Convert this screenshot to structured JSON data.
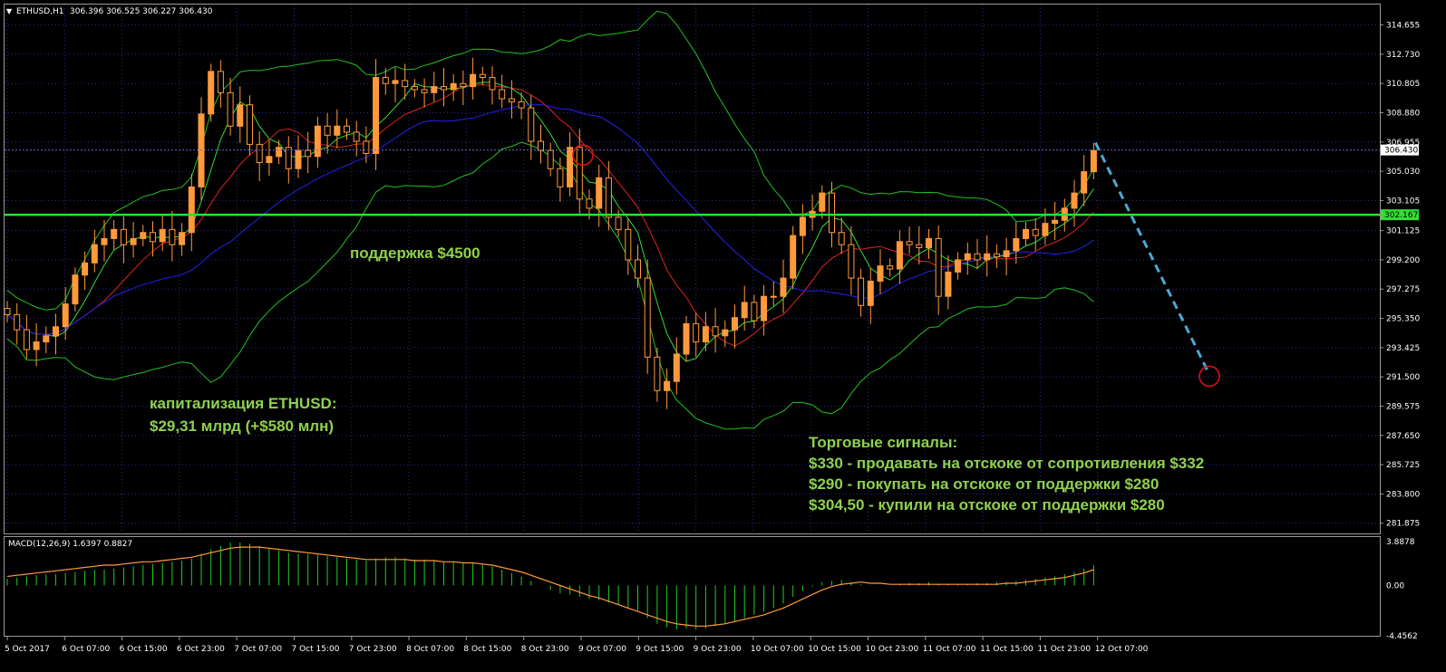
{
  "header": {
    "symbol": "ETHUSD,H1",
    "ohlc": "306.396 306.525 306.227 306.430"
  },
  "macd_header": "MACD(12,26,9) 1.6397 0.8827",
  "annotations": {
    "support_label": "поддержка $4500",
    "cap_line1": "капитализация ETHUSD:",
    "cap_line2": "$29,31 млрд (+$580 млн)",
    "signals_title": "Торговые сигналы:",
    "signal_1": "$330 - продавать на отскоке от сопротивления $332",
    "signal_2": "$290 - покупать на отскоке от поддержки $280",
    "signal_3": "$304,50 - купили на отскоке от поддержки $280"
  },
  "colors": {
    "background": "#000000",
    "grid": "#2b2b8a",
    "bull": "#ff9a3c",
    "bear": "#ff9a3c",
    "bollinger": "#22c022",
    "ma_fast": "#33dd33",
    "ma_mid": "#dd2222",
    "ma_slow": "#2222ee",
    "support_line": "#33dd33",
    "forecast": "#4aa9d6",
    "circle": "#dd1111",
    "macd_hist": "#22cc22",
    "macd_signal": "#ff9a3c",
    "text": "#8fd14f"
  },
  "chart_data": {
    "type": "candlestick",
    "price_axis": {
      "ticks": [
        "314.655",
        "312.730",
        "310.805",
        "308.880",
        "306.955",
        "305.030",
        "303.105",
        "301.125",
        "299.200",
        "297.275",
        "295.350",
        "293.425",
        "291.500",
        "289.575",
        "287.650",
        "285.725",
        "283.800",
        "281.875"
      ],
      "range": [
        281.2,
        316.0
      ]
    },
    "current_price": "306.430",
    "support_price": "302.167",
    "time_axis": [
      "5 Oct 2017",
      "6 Oct 07:00",
      "6 Oct 15:00",
      "6 Oct 23:00",
      "7 Oct 07:00",
      "7 Oct 15:00",
      "7 Oct 23:00",
      "8 Oct 07:00",
      "8 Oct 15:00",
      "8 Oct 23:00",
      "9 Oct 07:00",
      "9 Oct 15:00",
      "9 Oct 23:00",
      "10 Oct 07:00",
      "10 Oct 15:00",
      "10 Oct 23:00",
      "11 Oct 07:00",
      "11 Oct 15:00",
      "11 Oct 23:00",
      "12 Oct 07:00"
    ],
    "macd_axis": [
      "3.8878",
      "0.00",
      "-4.4562"
    ],
    "macd_range": [
      -4.4562,
      3.8878
    ],
    "close": [
      295.6,
      294.6,
      293.3,
      293.8,
      294.2,
      294.8,
      296.3,
      298.2,
      299.0,
      300.2,
      300.6,
      301.2,
      300.2,
      300.6,
      301.0,
      300.4,
      301.2,
      300.2,
      301.0,
      304.0,
      308.8,
      311.6,
      310.2,
      308.0,
      309.4,
      306.8,
      305.6,
      306.0,
      306.6,
      305.2,
      306.4,
      306.0,
      308.0,
      307.4,
      308.0,
      307.6,
      307.0,
      306.2,
      311.2,
      310.8,
      311.0,
      310.6,
      310.4,
      310.2,
      310.6,
      310.4,
      310.8,
      310.6,
      311.4,
      311.2,
      310.4,
      309.8,
      309.6,
      309.2,
      307.0,
      306.4,
      305.2,
      304.0,
      306.6,
      303.2,
      302.6,
      304.6,
      302.0,
      301.2,
      299.2,
      298.0,
      292.8,
      290.6,
      291.2,
      293.0,
      295.0,
      293.8,
      294.8,
      294.2,
      294.6,
      295.4,
      296.4,
      295.2,
      296.8,
      296.8,
      298.0,
      300.8,
      302.0,
      302.4,
      303.6,
      301.0,
      300.2,
      298.0,
      296.2,
      297.8,
      298.8,
      298.6,
      300.4,
      300.2,
      300.0,
      300.6,
      296.8,
      298.4,
      299.2,
      299.6,
      299.2,
      299.6,
      299.4,
      299.8,
      300.6,
      301.2,
      300.8,
      301.6,
      301.8,
      302.6,
      303.6,
      305.0,
      306.4
    ],
    "macd_hist_series": [
      0.6,
      0.7,
      0.8,
      0.9,
      1.0,
      1.0,
      1.1,
      1.2,
      1.3,
      1.4,
      1.4,
      1.5,
      1.6,
      1.7,
      1.8,
      1.9,
      2.0,
      2.1,
      2.2,
      2.4,
      2.8,
      3.2,
      3.5,
      3.8,
      3.8,
      3.7,
      3.5,
      3.3,
      3.1,
      2.9,
      2.8,
      2.8,
      2.7,
      2.6,
      2.5,
      2.4,
      2.3,
      2.2,
      2.4,
      2.5,
      2.5,
      2.4,
      2.3,
      2.3,
      2.2,
      2.1,
      2.1,
      2.0,
      2.0,
      1.9,
      1.7,
      1.4,
      1.1,
      0.8,
      0.4,
      0.0,
      -0.4,
      -0.7,
      -0.8,
      -1.0,
      -1.2,
      -1.3,
      -1.5,
      -1.7,
      -2.0,
      -2.2,
      -2.9,
      -3.4,
      -3.7,
      -3.9,
      -3.8,
      -3.9,
      -3.8,
      -3.6,
      -3.4,
      -3.2,
      -2.9,
      -2.6,
      -2.3,
      -2.0,
      -1.6,
      -1.0,
      -0.5,
      -0.1,
      0.3,
      0.4,
      0.5,
      0.3,
      0.1,
      0.0,
      0.0,
      0.0,
      0.1,
      0.2,
      0.2,
      0.3,
      0.1,
      0.1,
      0.1,
      0.1,
      0.2,
      0.2,
      0.3,
      0.3,
      0.4,
      0.5,
      0.6,
      0.7,
      0.8,
      1.0,
      1.2,
      1.5,
      1.8
    ],
    "macd_signal_series": [
      0.8,
      0.9,
      1.0,
      1.1,
      1.2,
      1.3,
      1.4,
      1.5,
      1.6,
      1.7,
      1.8,
      1.8,
      1.9,
      2.0,
      2.1,
      2.1,
      2.2,
      2.3,
      2.4,
      2.5,
      2.7,
      2.9,
      3.1,
      3.3,
      3.4,
      3.4,
      3.4,
      3.3,
      3.2,
      3.1,
      3.0,
      2.9,
      2.8,
      2.7,
      2.6,
      2.5,
      2.4,
      2.3,
      2.3,
      2.3,
      2.3,
      2.3,
      2.2,
      2.2,
      2.2,
      2.1,
      2.1,
      2.0,
      2.0,
      1.9,
      1.8,
      1.6,
      1.4,
      1.2,
      0.9,
      0.6,
      0.3,
      0.0,
      -0.3,
      -0.6,
      -0.9,
      -1.1,
      -1.4,
      -1.7,
      -2.0,
      -2.3,
      -2.6,
      -2.9,
      -3.2,
      -3.4,
      -3.5,
      -3.6,
      -3.6,
      -3.5,
      -3.4,
      -3.2,
      -3.0,
      -2.8,
      -2.6,
      -2.3,
      -2.0,
      -1.6,
      -1.2,
      -0.8,
      -0.4,
      -0.1,
      0.1,
      0.2,
      0.3,
      0.2,
      0.2,
      0.1,
      0.1,
      0.1,
      0.1,
      0.1,
      0.1,
      0.1,
      0.1,
      0.1,
      0.1,
      0.1,
      0.1,
      0.2,
      0.2,
      0.3,
      0.4,
      0.5,
      0.6,
      0.7,
      0.9,
      1.1,
      1.4
    ]
  }
}
